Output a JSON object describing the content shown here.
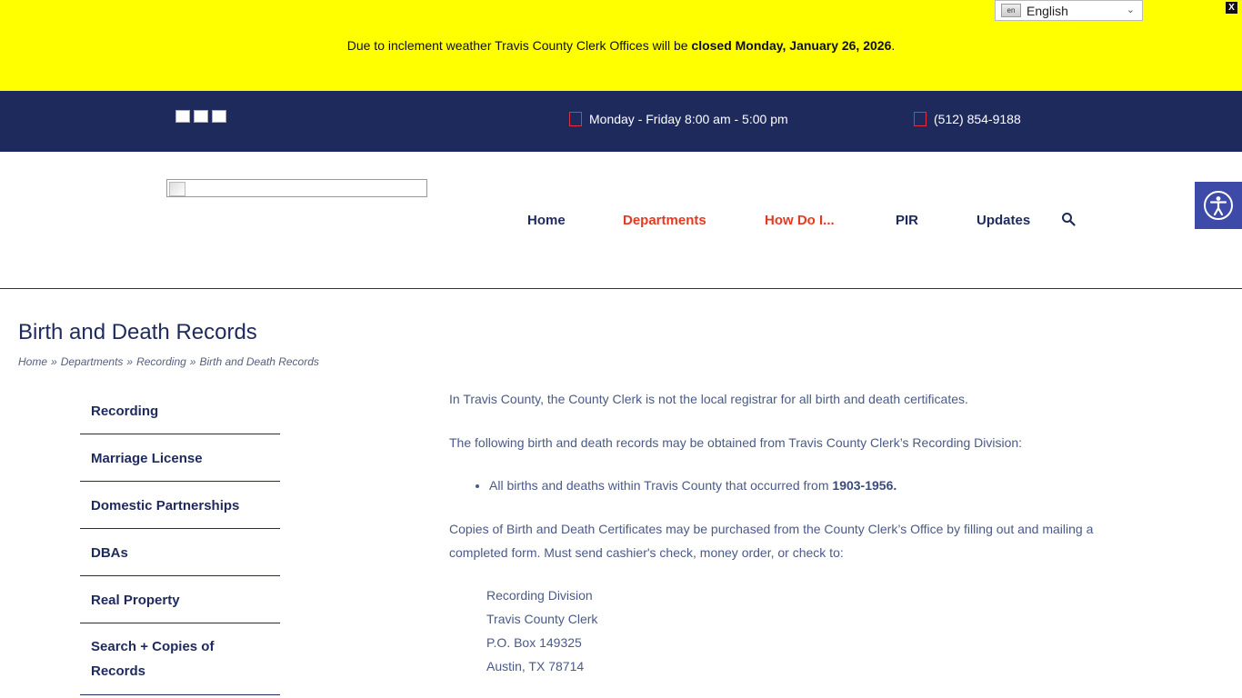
{
  "alert": {
    "text_prefix": "Due to inclement weather Travis County Clerk Offices will be ",
    "text_bold": "closed Monday, January 26, 2026",
    "text_suffix": ".",
    "close_label": "X"
  },
  "language": {
    "flag_text": "en",
    "selected": "English"
  },
  "topbar": {
    "hours": "Monday - Friday 8:00 am - 5:00 pm",
    "phone": "(512) 854-9188"
  },
  "nav": {
    "items": [
      {
        "label": "Home"
      },
      {
        "label": "Departments"
      },
      {
        "label": "How Do I..."
      },
      {
        "label": "PIR"
      },
      {
        "label": "Updates"
      }
    ]
  },
  "page": {
    "title": "Birth and Death Records",
    "breadcrumb": [
      "Home",
      "Departments",
      "Recording",
      "Birth and Death Records"
    ],
    "breadcrumb_separator": "»"
  },
  "sidebar": {
    "items": [
      {
        "label": "Recording"
      },
      {
        "label": "Marriage License"
      },
      {
        "label": "Domestic Partnerships"
      },
      {
        "label": "DBAs"
      },
      {
        "label": "Real Property"
      },
      {
        "label": "Search + Copies of Records"
      }
    ]
  },
  "content": {
    "p1": "In Travis County, the County Clerk is not the local registrar for all birth and death certificates.",
    "p2": "The following birth and death records may be obtained from Travis County Clerk’s Recording Division:",
    "bullet_text": "All births and deaths within Travis County that occurred from ",
    "bullet_bold": "1903-1956.",
    "p3": "Copies of Birth and Death Certificates may be purchased from the County Clerk’s Office by filling out and mailing a completed form. Must send cashier's check, money order, or check to:",
    "address": [
      "Recording Division",
      "Travis County Clerk",
      "P.O. Box 149325",
      "Austin, TX 78714"
    ]
  },
  "colors": {
    "alert_bg": "#ffff00",
    "navy": "#1f2a5c",
    "accent_red": "#e53a20",
    "a11y_blue": "#3d4aa7"
  }
}
